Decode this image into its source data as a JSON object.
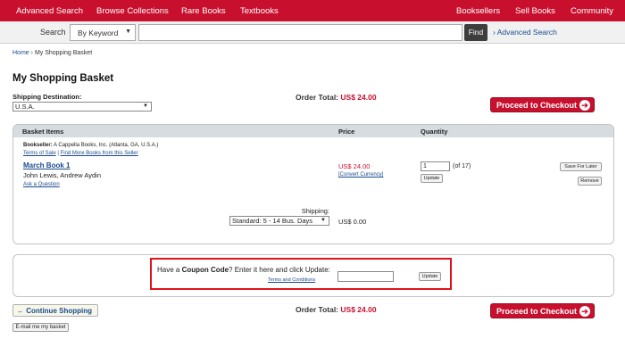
{
  "topnav": {
    "left": [
      "Advanced Search",
      "Browse Collections",
      "Rare Books",
      "Textbooks"
    ],
    "right": [
      "Booksellers",
      "Sell Books",
      "Community"
    ]
  },
  "search": {
    "label": "Search",
    "mode": "By Keyword",
    "value": "",
    "find": "Find",
    "advanced": "Advanced Search"
  },
  "breadcrumb": {
    "home": "Home",
    "sep": "›",
    "current": "My Shopping Basket"
  },
  "page": {
    "title": "My Shopping Basket",
    "shipping_destination_label": "Shipping Destination:",
    "shipping_destination": "U.S.A.",
    "order_total_label": "Order Total:",
    "order_total": "US$ 24.00",
    "checkout": "Proceed to Checkout"
  },
  "items_table": {
    "headers": {
      "items": "Basket Items",
      "price": "Price",
      "quantity": "Quantity"
    },
    "item": {
      "bookseller_label": "Bookseller:",
      "bookseller": "A Cappella Books, Inc. (Atlanta, GA, U.S.A.)",
      "terms": "Terms of Sale",
      "link_sep": "|",
      "more_books": "Find More Books from this Seller",
      "title": "March Book 1",
      "authors": "John Lewis, Andrew Aydin",
      "ask": "Ask a Question",
      "price": "US$ 24.00",
      "convert": "[Convert Currency]",
      "quantity": "1",
      "qty_of": "(of 17)",
      "update": "Update",
      "save_later": "Save For Later",
      "remove": "Remove"
    },
    "shipping_label": "Shipping:",
    "shipping_option": "Standard: 5 - 14 Bus. Days",
    "shipping_cost": "US$ 0.00"
  },
  "coupon": {
    "text_pre": "Have a",
    "text_bold": "Coupon Code",
    "text_post": "? Enter it here and click Update:",
    "terms": "Terms and Conditions",
    "value": "",
    "update": "Update"
  },
  "footer": {
    "continue": "Continue Shopping",
    "email": "E-mail me my basket"
  }
}
